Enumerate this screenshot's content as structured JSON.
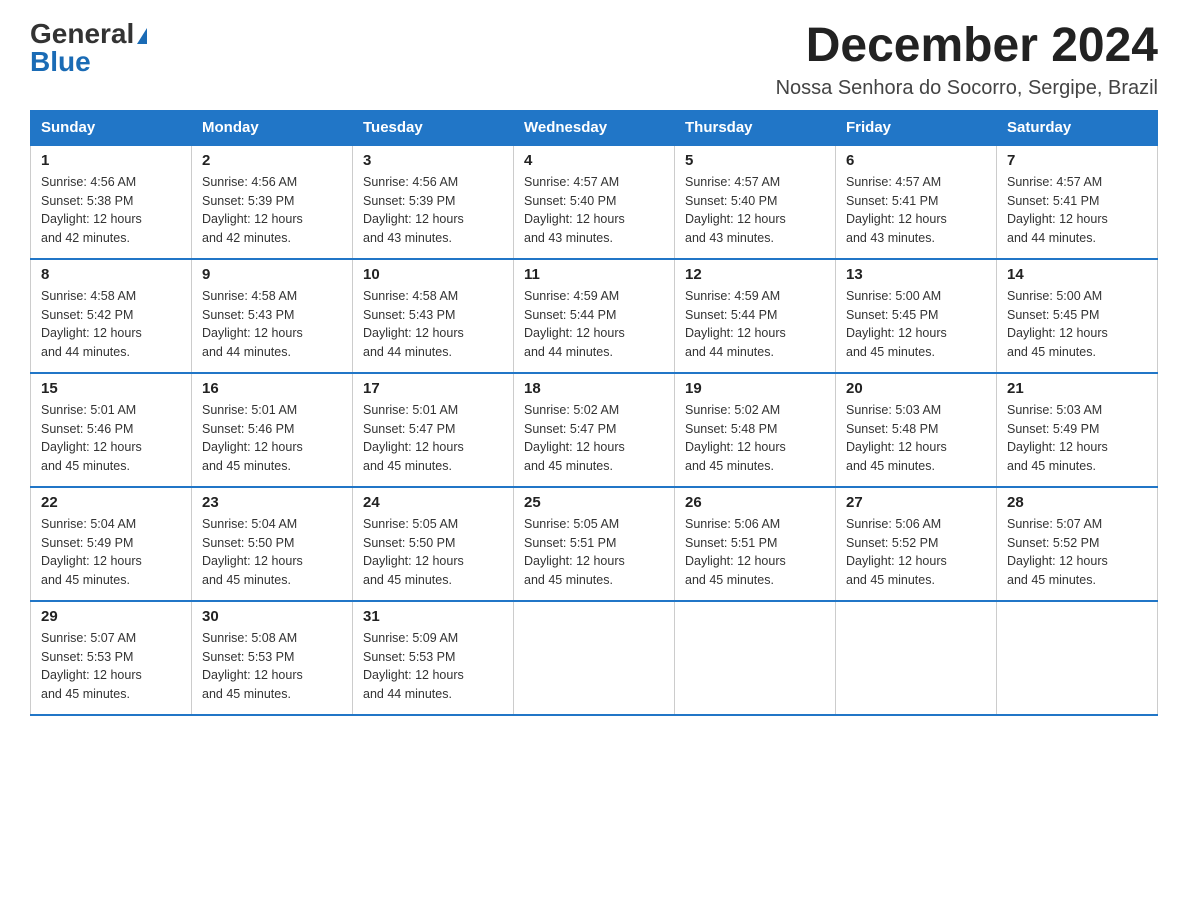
{
  "header": {
    "logo_general": "General",
    "logo_blue": "Blue",
    "month_year": "December 2024",
    "location": "Nossa Senhora do Socorro, Sergipe, Brazil"
  },
  "days_of_week": [
    "Sunday",
    "Monday",
    "Tuesday",
    "Wednesday",
    "Thursday",
    "Friday",
    "Saturday"
  ],
  "weeks": [
    [
      {
        "day": "1",
        "sunrise": "4:56 AM",
        "sunset": "5:38 PM",
        "daylight": "12 hours and 42 minutes."
      },
      {
        "day": "2",
        "sunrise": "4:56 AM",
        "sunset": "5:39 PM",
        "daylight": "12 hours and 42 minutes."
      },
      {
        "day": "3",
        "sunrise": "4:56 AM",
        "sunset": "5:39 PM",
        "daylight": "12 hours and 43 minutes."
      },
      {
        "day": "4",
        "sunrise": "4:57 AM",
        "sunset": "5:40 PM",
        "daylight": "12 hours and 43 minutes."
      },
      {
        "day": "5",
        "sunrise": "4:57 AM",
        "sunset": "5:40 PM",
        "daylight": "12 hours and 43 minutes."
      },
      {
        "day": "6",
        "sunrise": "4:57 AM",
        "sunset": "5:41 PM",
        "daylight": "12 hours and 43 minutes."
      },
      {
        "day": "7",
        "sunrise": "4:57 AM",
        "sunset": "5:41 PM",
        "daylight": "12 hours and 44 minutes."
      }
    ],
    [
      {
        "day": "8",
        "sunrise": "4:58 AM",
        "sunset": "5:42 PM",
        "daylight": "12 hours and 44 minutes."
      },
      {
        "day": "9",
        "sunrise": "4:58 AM",
        "sunset": "5:43 PM",
        "daylight": "12 hours and 44 minutes."
      },
      {
        "day": "10",
        "sunrise": "4:58 AM",
        "sunset": "5:43 PM",
        "daylight": "12 hours and 44 minutes."
      },
      {
        "day": "11",
        "sunrise": "4:59 AM",
        "sunset": "5:44 PM",
        "daylight": "12 hours and 44 minutes."
      },
      {
        "day": "12",
        "sunrise": "4:59 AM",
        "sunset": "5:44 PM",
        "daylight": "12 hours and 44 minutes."
      },
      {
        "day": "13",
        "sunrise": "5:00 AM",
        "sunset": "5:45 PM",
        "daylight": "12 hours and 45 minutes."
      },
      {
        "day": "14",
        "sunrise": "5:00 AM",
        "sunset": "5:45 PM",
        "daylight": "12 hours and 45 minutes."
      }
    ],
    [
      {
        "day": "15",
        "sunrise": "5:01 AM",
        "sunset": "5:46 PM",
        "daylight": "12 hours and 45 minutes."
      },
      {
        "day": "16",
        "sunrise": "5:01 AM",
        "sunset": "5:46 PM",
        "daylight": "12 hours and 45 minutes."
      },
      {
        "day": "17",
        "sunrise": "5:01 AM",
        "sunset": "5:47 PM",
        "daylight": "12 hours and 45 minutes."
      },
      {
        "day": "18",
        "sunrise": "5:02 AM",
        "sunset": "5:47 PM",
        "daylight": "12 hours and 45 minutes."
      },
      {
        "day": "19",
        "sunrise": "5:02 AM",
        "sunset": "5:48 PM",
        "daylight": "12 hours and 45 minutes."
      },
      {
        "day": "20",
        "sunrise": "5:03 AM",
        "sunset": "5:48 PM",
        "daylight": "12 hours and 45 minutes."
      },
      {
        "day": "21",
        "sunrise": "5:03 AM",
        "sunset": "5:49 PM",
        "daylight": "12 hours and 45 minutes."
      }
    ],
    [
      {
        "day": "22",
        "sunrise": "5:04 AM",
        "sunset": "5:49 PM",
        "daylight": "12 hours and 45 minutes."
      },
      {
        "day": "23",
        "sunrise": "5:04 AM",
        "sunset": "5:50 PM",
        "daylight": "12 hours and 45 minutes."
      },
      {
        "day": "24",
        "sunrise": "5:05 AM",
        "sunset": "5:50 PM",
        "daylight": "12 hours and 45 minutes."
      },
      {
        "day": "25",
        "sunrise": "5:05 AM",
        "sunset": "5:51 PM",
        "daylight": "12 hours and 45 minutes."
      },
      {
        "day": "26",
        "sunrise": "5:06 AM",
        "sunset": "5:51 PM",
        "daylight": "12 hours and 45 minutes."
      },
      {
        "day": "27",
        "sunrise": "5:06 AM",
        "sunset": "5:52 PM",
        "daylight": "12 hours and 45 minutes."
      },
      {
        "day": "28",
        "sunrise": "5:07 AM",
        "sunset": "5:52 PM",
        "daylight": "12 hours and 45 minutes."
      }
    ],
    [
      {
        "day": "29",
        "sunrise": "5:07 AM",
        "sunset": "5:53 PM",
        "daylight": "12 hours and 45 minutes."
      },
      {
        "day": "30",
        "sunrise": "5:08 AM",
        "sunset": "5:53 PM",
        "daylight": "12 hours and 45 minutes."
      },
      {
        "day": "31",
        "sunrise": "5:09 AM",
        "sunset": "5:53 PM",
        "daylight": "12 hours and 44 minutes."
      },
      null,
      null,
      null,
      null
    ]
  ],
  "labels": {
    "sunrise_prefix": "Sunrise: ",
    "sunset_prefix": "Sunset: ",
    "daylight_prefix": "Daylight: "
  }
}
